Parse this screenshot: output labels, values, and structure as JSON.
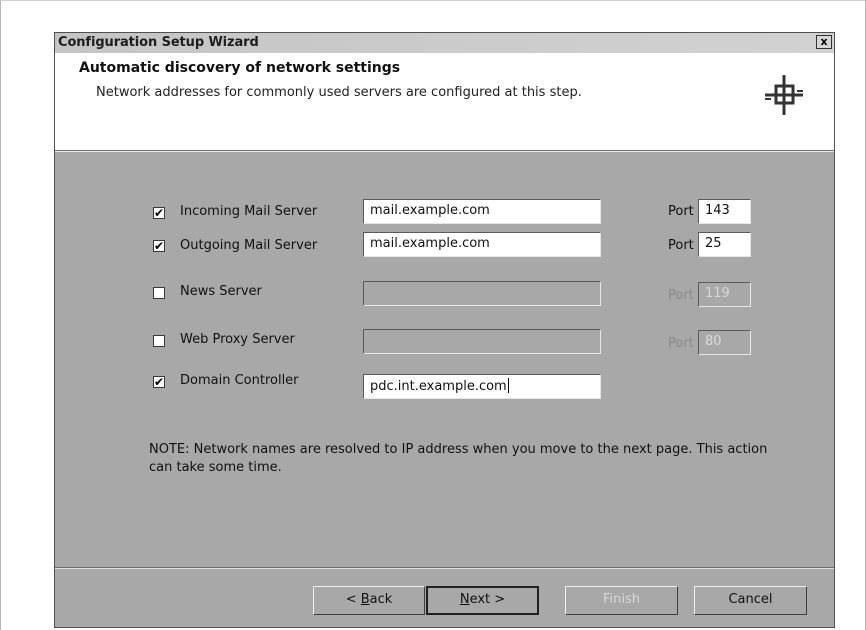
{
  "window": {
    "title": "Configuration Setup Wizard",
    "close_glyph": "x"
  },
  "header": {
    "title": "Automatic discovery of network settings",
    "subtitle": "Network addresses for commonly used servers are configured at this step.",
    "logo_icon": "wizard-logo-icon"
  },
  "servers": [
    {
      "label": "Incoming Mail Server",
      "checked": true,
      "address": "mail.example.com",
      "port_label": "Port",
      "port": "143",
      "enabled": true
    },
    {
      "label": "Outgoing Mail Server",
      "checked": true,
      "address": "mail.example.com",
      "port_label": "Port",
      "port": "25",
      "enabled": true
    },
    {
      "label": "News Server",
      "checked": false,
      "address": "",
      "port_label": "Port",
      "port": "119",
      "enabled": false
    },
    {
      "label": "Web Proxy Server",
      "checked": false,
      "address": "",
      "port_label": "Port",
      "port": "80",
      "enabled": false
    },
    {
      "label": "Domain Controller",
      "checked": true,
      "address": "pdc.int.example.com",
      "enabled": true
    }
  ],
  "check_glyph": "✔",
  "note": "NOTE: Network names are resolved to IP address when you move to the next page. This action can take some time.",
  "buttons": {
    "back": {
      "prefix": "< ",
      "mnemonic": "B",
      "rest": "ack"
    },
    "next": {
      "mnemonic": "N",
      "rest": "ext >"
    },
    "finish": "Finish",
    "cancel": "Cancel"
  }
}
